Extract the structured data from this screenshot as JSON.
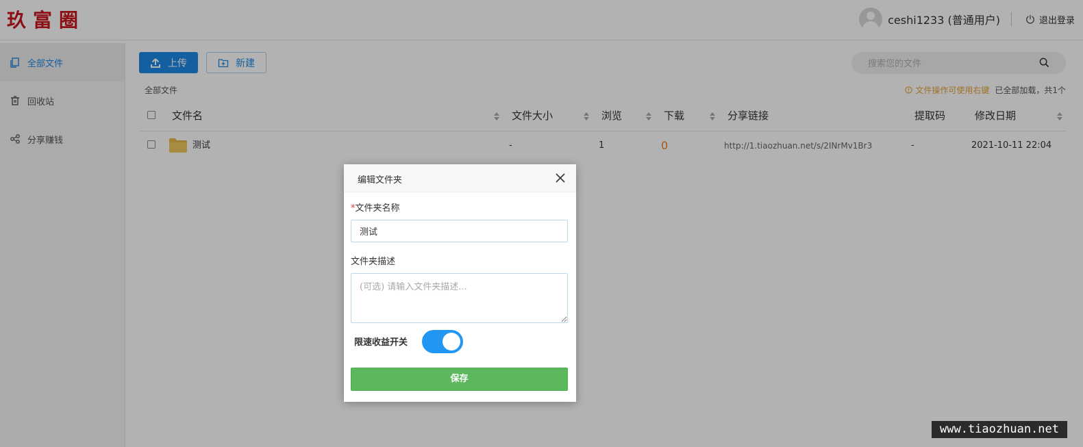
{
  "app": {
    "logo_text": "玖富圈"
  },
  "header": {
    "user_name": "ceshi1233 (普通用户)",
    "logout_label": "退出登录"
  },
  "sidebar": {
    "items": [
      {
        "label": "全部文件",
        "icon": "files-icon",
        "active": true
      },
      {
        "label": "回收站",
        "icon": "trash-icon",
        "active": false
      },
      {
        "label": "分享赚钱",
        "icon": "share-icon",
        "active": false
      }
    ]
  },
  "toolbar": {
    "upload_label": "上传",
    "new_label": "新建",
    "search_placeholder": "搜索您的文件"
  },
  "breadcrumb": "全部文件",
  "tip": {
    "warning": "文件操作可使用右键",
    "status": "已全部加载，共1个"
  },
  "table": {
    "headers": [
      "文件名",
      "文件大小",
      "浏览",
      "下载",
      "分享链接",
      "提取码",
      "修改日期"
    ],
    "rows": [
      {
        "name": "测试",
        "size": "-",
        "views": "1",
        "downloads": "0",
        "link": "http://1.tiaozhuan.net/s/2INrMv1Br3",
        "code": "-",
        "date": "2021-10-11 22:04"
      }
    ]
  },
  "modal": {
    "title": "编辑文件夹",
    "name_label": "文件夹名称",
    "required_mark": "*",
    "name_value": "测试",
    "desc_label": "文件夹描述",
    "desc_placeholder": "(可选) 请输入文件夹描述...",
    "toggle_label": "限速收益开关",
    "toggle_on": true,
    "save_label": "保存"
  },
  "watermark": "www.tiaozhuan.net",
  "colors": {
    "accent": "#1e88e5",
    "logo": "#c8161d",
    "save": "#5cb85c",
    "toggle": "#2196f3",
    "warning": "#e6a23c",
    "download_count": "#e67e22"
  }
}
